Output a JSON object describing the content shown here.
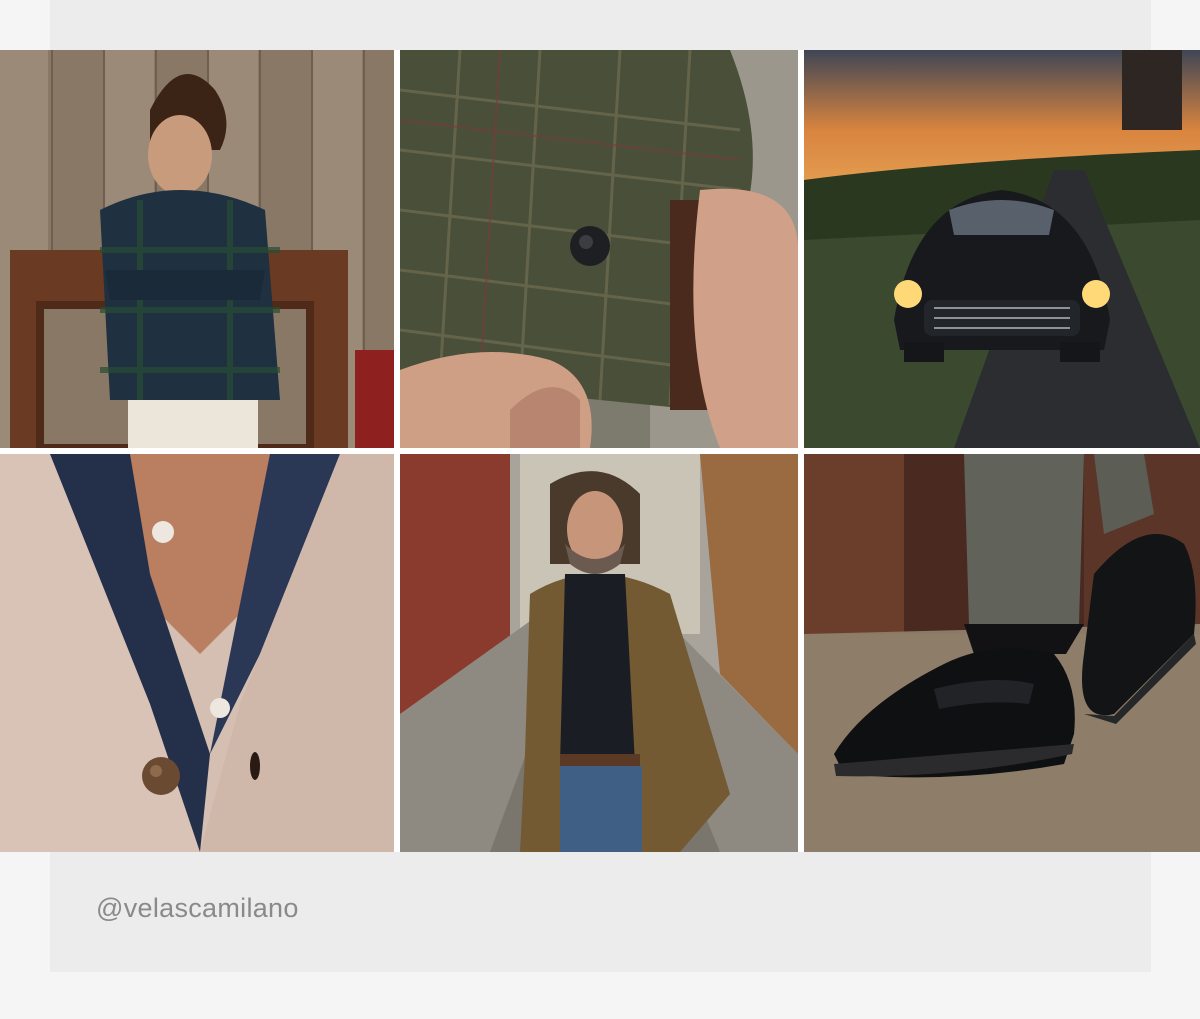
{
  "footer": {
    "instagram_handle": "@velascamilano"
  },
  "gallery": {
    "images": [
      {
        "icon": "photo-icon",
        "subject": "man-plaid-overshirt"
      },
      {
        "icon": "photo-icon",
        "subject": "tweed-cuff-button"
      },
      {
        "icon": "photo-icon",
        "subject": "classic-car-sunset"
      },
      {
        "icon": "photo-icon",
        "subject": "cardigan-buttons"
      },
      {
        "icon": "photo-icon",
        "subject": "man-camel-coat-street"
      },
      {
        "icon": "photo-icon",
        "subject": "black-penny-loafers"
      }
    ]
  },
  "colors": {
    "panel": "#ececec",
    "page": "#f5f5f5",
    "handle_text": "#8a8a8a"
  }
}
